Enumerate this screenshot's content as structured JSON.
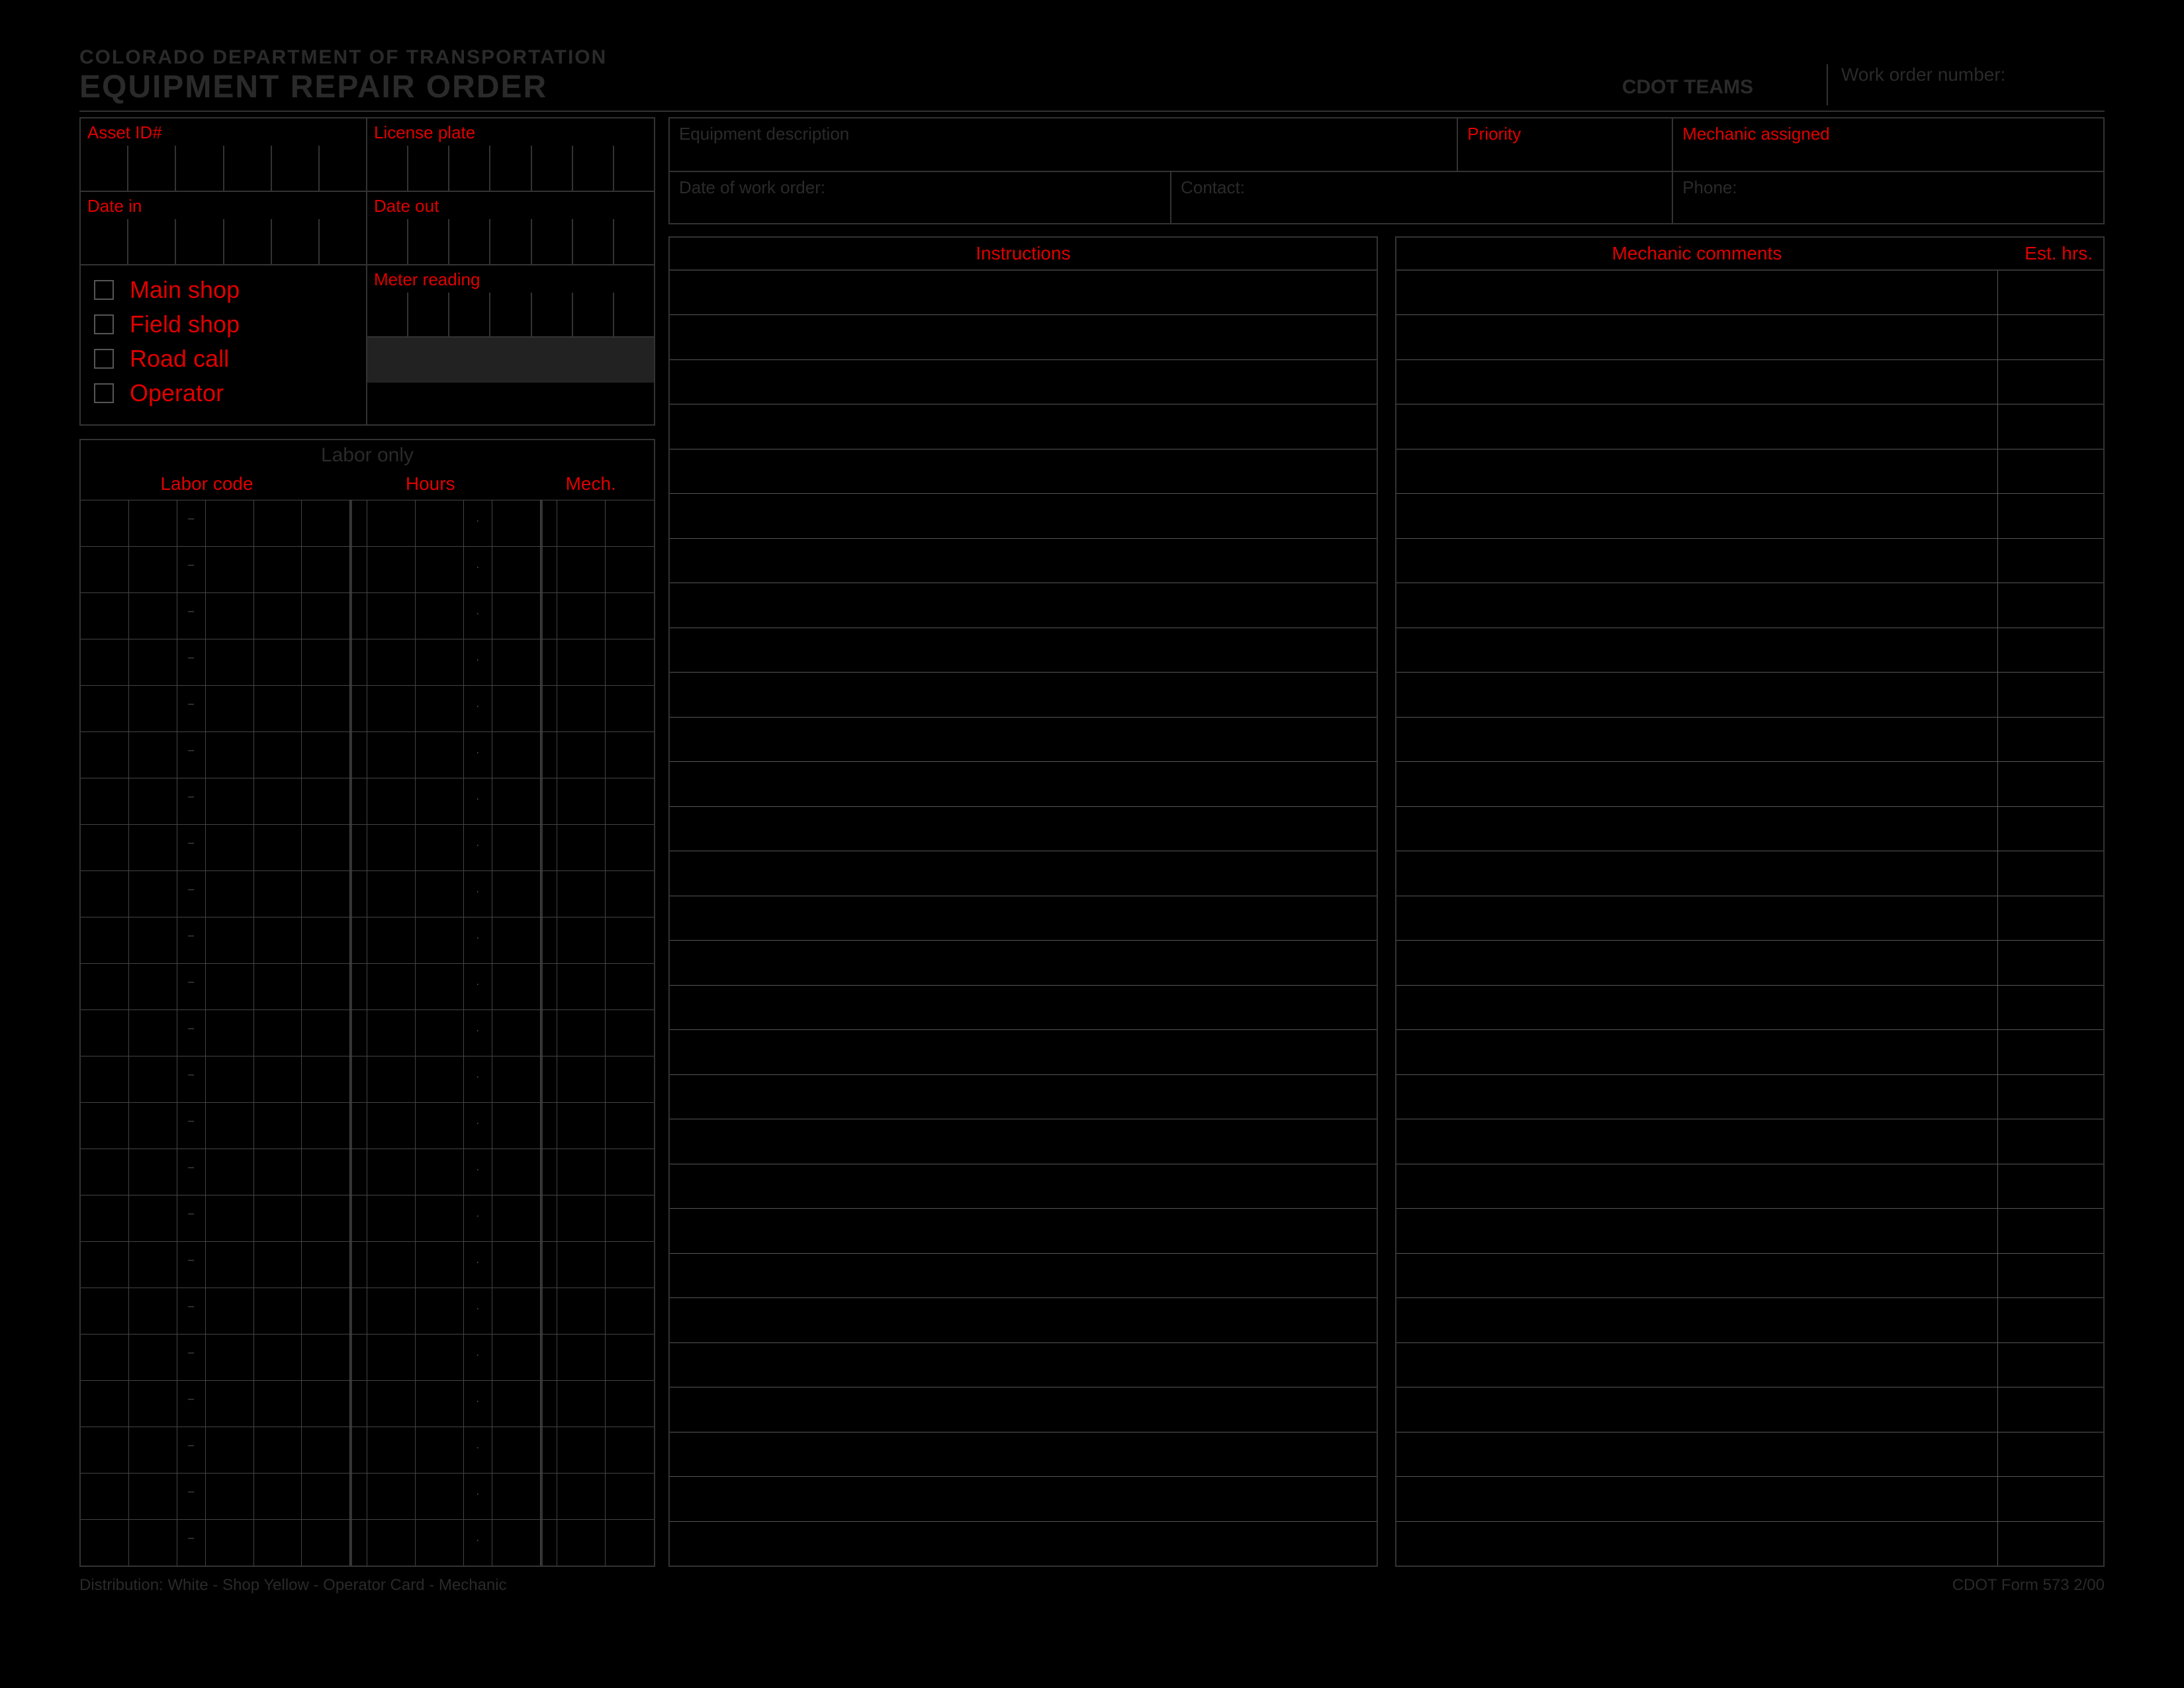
{
  "header": {
    "department": "COLORADO DEPARTMENT OF TRANSPORTATION",
    "title": "EQUIPMENT REPAIR ORDER",
    "teams": "CDOT TEAMS",
    "work_order_label": "Work order number:"
  },
  "asset": {
    "asset_id_label": "Asset ID#",
    "license_label": "License plate",
    "date_in_label": "Date in",
    "date_out_label": "Date out",
    "meter_label": "Meter reading"
  },
  "checks": {
    "main_shop": "Main shop",
    "field_shop": "Field shop",
    "road_call": "Road call",
    "operator": "Operator"
  },
  "labor": {
    "section_title": "Labor only",
    "code_label": "Labor code",
    "hours_label": "Hours",
    "mech_label": "Mech.",
    "row_count": 23
  },
  "info": {
    "equip_desc": "Equipment description",
    "priority": "Priority",
    "mech_assigned": "Mechanic assigned",
    "date_of_wo": "Date of work order:",
    "contact": "Contact:",
    "phone": "Phone:"
  },
  "instructions": {
    "title": "Instructions",
    "comments_title": "Mechanic comments",
    "est_hrs": "Est. hrs.",
    "line_count": 29
  },
  "footer": {
    "distribution": "Distribution:   White - Shop   Yellow - Operator    Card - Mechanic",
    "form_id": "CDOT Form 573   2/00"
  }
}
